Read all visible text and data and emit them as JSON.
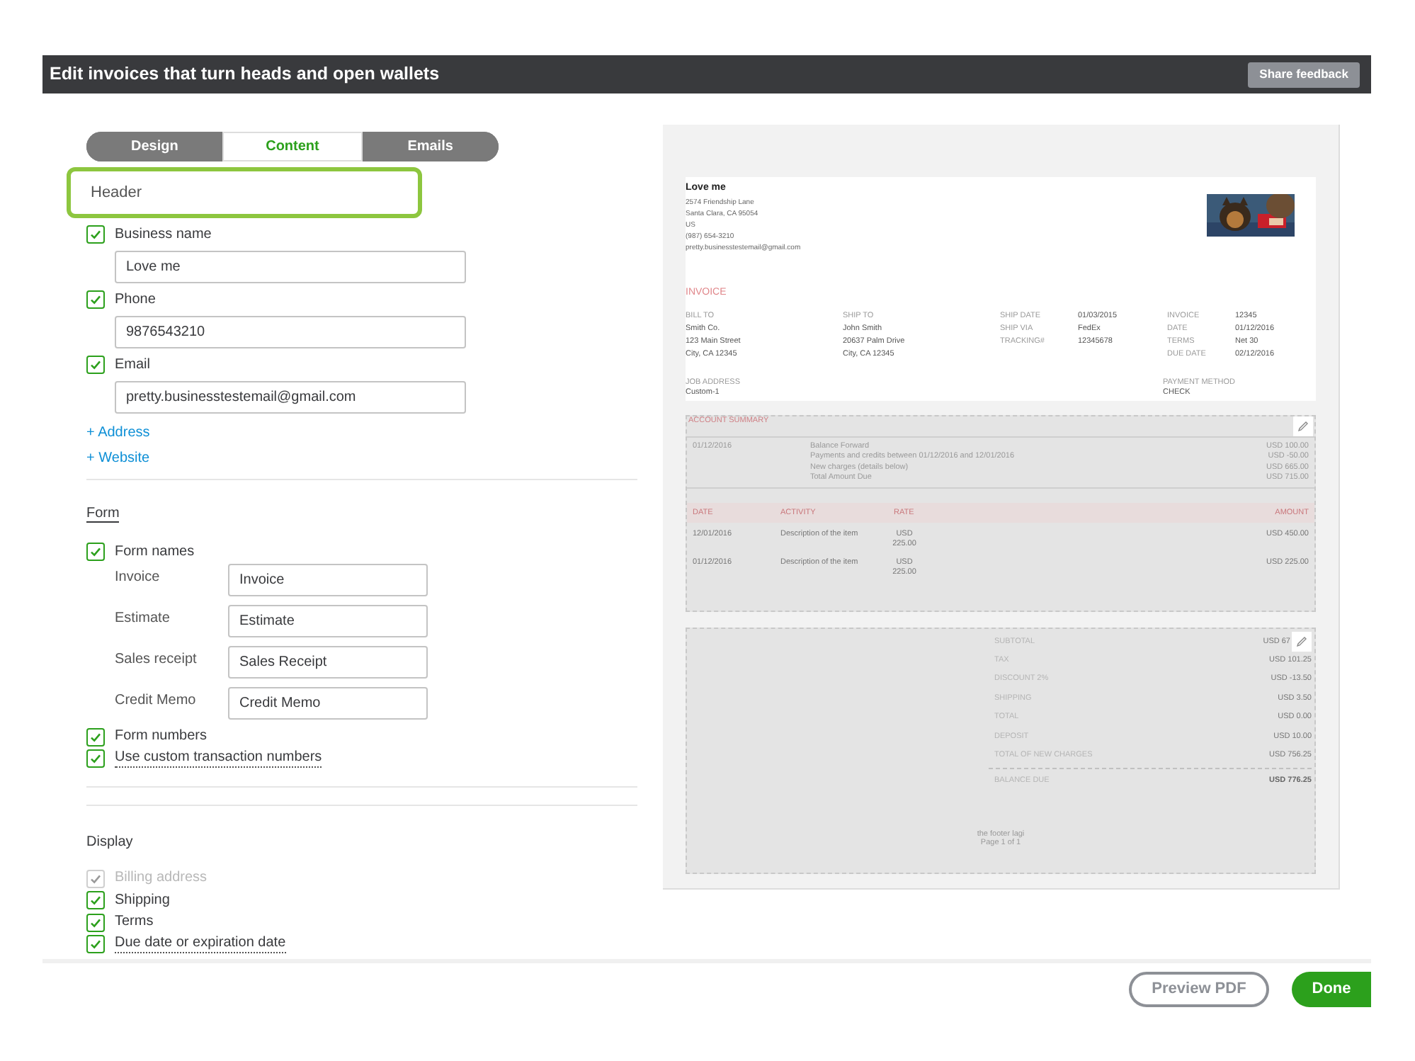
{
  "top_bar": {
    "title": "Edit invoices that turn heads and open wallets",
    "feedback_button": "Share feedback"
  },
  "tabs": [
    {
      "label": "Design",
      "selected": false
    },
    {
      "label": "Content",
      "selected": true
    },
    {
      "label": "Emails",
      "selected": false
    }
  ],
  "header_section": {
    "title": "Header",
    "focused": true,
    "fields": [
      {
        "label": "Business name",
        "checked": true,
        "value": "Love me"
      },
      {
        "label": "Phone",
        "checked": true,
        "value": "9876543210"
      },
      {
        "label": "Email",
        "checked": true,
        "value": "pretty.businesstestemail@gmail.com"
      }
    ],
    "links": [
      "+ Address",
      "+ Website"
    ]
  },
  "form_section": {
    "title": "Form",
    "form_names": {
      "label": "Form names",
      "checked": true
    },
    "names": [
      {
        "label": "Invoice",
        "value": "Invoice"
      },
      {
        "label": "Estimate",
        "value": "Estimate"
      },
      {
        "label": "Sales receipt",
        "value": "Sales Receipt"
      },
      {
        "label": "Credit Memo",
        "value": "Credit Memo"
      }
    ],
    "options": [
      {
        "label": "Form numbers",
        "checked": true,
        "kind": "plain",
        "disabled": false
      },
      {
        "label": "Use custom transaction numbers",
        "checked": true,
        "kind": "hint",
        "disabled": false
      }
    ]
  },
  "display_section": {
    "title": "Display",
    "options": [
      {
        "label": "Billing address",
        "checked": true,
        "kind": "plain",
        "disabled": true
      },
      {
        "label": "Shipping",
        "checked": true,
        "kind": "plain",
        "disabled": false
      },
      {
        "label": "Terms",
        "checked": true,
        "kind": "plain",
        "disabled": false
      },
      {
        "label": "Due date or expiration date",
        "checked": true,
        "kind": "hint",
        "disabled": false
      }
    ]
  },
  "preview": {
    "company": "Love me",
    "address_lines": [
      "2574  Friendship Lane",
      "Santa Clara, CA 95054",
      "US",
      "(987) 654-3210",
      "pretty.businesstestemail@gmail.com"
    ],
    "photo": {
      "kind": "picture"
    },
    "doc_title": "INVOICE",
    "bill_to": {
      "label": "BILL TO",
      "lines": [
        "Smith Co.",
        "123 Main Street",
        "City, CA 12345"
      ]
    },
    "ship_to": {
      "label": "SHIP TO",
      "lines": [
        "John Smith",
        "20637 Palm Drive",
        "City, CA 12345"
      ]
    },
    "ship_info": [
      {
        "label": "SHIP DATE",
        "value": "01/03/2015"
      },
      {
        "label": "SHIP VIA",
        "value": "FedEx"
      },
      {
        "label": "TRACKING#",
        "value": "12345678"
      }
    ],
    "invoice_info": [
      {
        "label": "INVOICE",
        "value": "12345"
      },
      {
        "label": "DATE",
        "value": "01/12/2016"
      },
      {
        "label": "TERMS",
        "value": "Net 30"
      },
      {
        "label": "DUE DATE",
        "value": "02/12/2016"
      }
    ],
    "job_address": {
      "label": "JOB ADDRESS",
      "value": "Custom-1"
    },
    "payment_method": {
      "label": "PAYMENT METHOD",
      "value": "CHECK"
    },
    "account_summary": {
      "title": "ACCOUNT SUMMARY",
      "date": "01/12/2016",
      "rows": [
        {
          "label": "Balance Forward",
          "amount": "USD 100.00"
        },
        {
          "label": "Payments and credits between 01/12/2016 and 12/01/2016",
          "amount": "USD -50.00"
        },
        {
          "label": "New charges (details below)",
          "amount": "USD 665.00"
        },
        {
          "label": "Total Amount Due",
          "amount": "USD 715.00"
        }
      ]
    },
    "lines_table": {
      "columns": [
        "DATE",
        "ACTIVITY",
        "RATE",
        "AMOUNT"
      ],
      "rows": [
        {
          "date": "12/01/2016",
          "activity": "Description of the item",
          "rate": "USD 225.00",
          "amount": "USD 450.00"
        },
        {
          "date": "01/12/2016",
          "activity": "Description of the item",
          "rate": "USD 225.00",
          "amount": "USD 225.00"
        }
      ]
    },
    "totals": [
      {
        "label": "SUBTOTAL",
        "value": "USD 67"
      },
      {
        "label": "TAX",
        "value": "USD 101.25"
      },
      {
        "label": "DISCOUNT 2%",
        "value": "USD -13.50"
      },
      {
        "label": "SHIPPING",
        "value": "USD 3.50"
      },
      {
        "label": "TOTAL",
        "value": "USD 0.00"
      },
      {
        "label": "DEPOSIT",
        "value": "USD 10.00"
      },
      {
        "label": "TOTAL OF NEW CHARGES",
        "value": "USD 756.25"
      }
    ],
    "balance_due": {
      "label": "BALANCE DUE",
      "value": "USD 776.25"
    },
    "footer": [
      "the footer lagi",
      "Page 1 of 1"
    ]
  },
  "actions": {
    "preview_pdf": "Preview PDF",
    "done": "Done"
  }
}
